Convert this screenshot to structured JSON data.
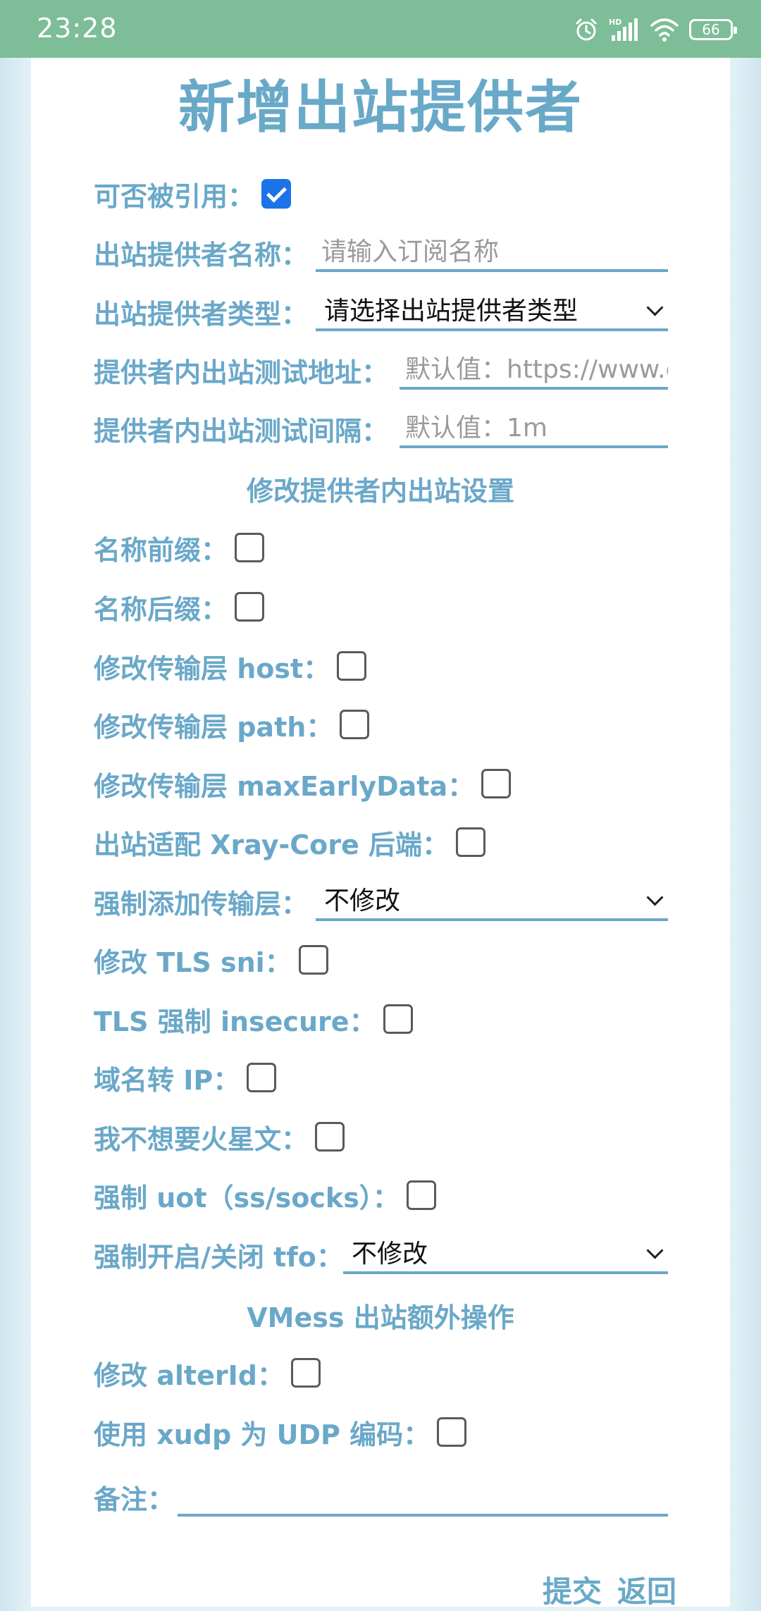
{
  "status_bar": {
    "time": "23:28",
    "battery": "66"
  },
  "title": "新增出站提供者",
  "form": {
    "quotable_label": "可否被引用：",
    "name_label": "出站提供者名称：",
    "name_placeholder": "请输入订阅名称",
    "type_label": "出站提供者类型：",
    "type_value": "请选择出站提供者类型",
    "test_url_label": "提供者内出站测试地址：",
    "test_url_placeholder": "默认值：https://www.g",
    "test_interval_label": "提供者内出站测试间隔：",
    "test_interval_placeholder": "默认值：1m"
  },
  "section_modify": "修改提供者内出站设置",
  "modify": {
    "name_prefix_label": "名称前缀：",
    "name_suffix_label": "名称后缀：",
    "host_label": "修改传输层 host：",
    "path_label": "修改传输层 path：",
    "max_early_data_label": "修改传输层 maxEarlyData：",
    "xray_label": "出站适配 Xray-Core 后端：",
    "force_transport_label": "强制添加传输层：",
    "force_transport_value": "不修改",
    "tls_sni_label": "修改 TLS sni：",
    "tls_insecure_label": "TLS 强制 insecure：",
    "domain_to_ip_label": "域名转 IP：",
    "no_mars_text_label": "我不想要火星文：",
    "force_uot_label": "强制 uot（ss/socks）：",
    "tfo_label": "强制开启/关闭 tfo：",
    "tfo_value": "不修改"
  },
  "section_vmess": "VMess 出站额外操作",
  "vmess": {
    "alter_id_label": "修改 alterId：",
    "xudp_label": "使用 xudp 为 UDP 编码："
  },
  "remark_label": "备注：",
  "actions": {
    "submit": "提交",
    "back": "返回"
  }
}
